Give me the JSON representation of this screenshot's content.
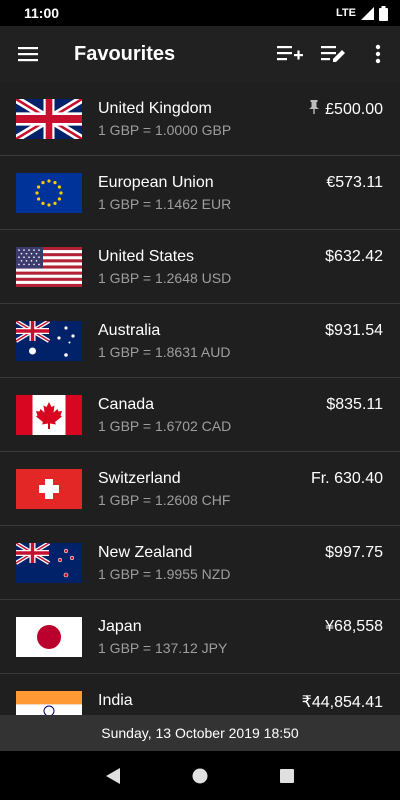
{
  "status": {
    "time": "11:00",
    "network": "LTE"
  },
  "appbar": {
    "title": "Favourites",
    "icons": [
      "menu-icon",
      "add-list-icon",
      "edit-list-icon",
      "more-vert-icon"
    ]
  },
  "rows": [
    {
      "country": "United Kingdom",
      "rate": "1 GBP = 1.0000 GBP",
      "amount": "£500.00",
      "flag": "uk",
      "pinned": true
    },
    {
      "country": "European Union",
      "rate": "1 GBP = 1.1462 EUR",
      "amount": "€573.11",
      "flag": "eu"
    },
    {
      "country": "United States",
      "rate": "1 GBP = 1.2648 USD",
      "amount": "$632.42",
      "flag": "us"
    },
    {
      "country": "Australia",
      "rate": "1 GBP = 1.8631 AUD",
      "amount": "$931.54",
      "flag": "au"
    },
    {
      "country": "Canada",
      "rate": "1 GBP = 1.6702 CAD",
      "amount": "$835.11",
      "flag": "ca"
    },
    {
      "country": "Switzerland",
      "rate": "1 GBP = 1.2608 CHF",
      "amount": "Fr. 630.40",
      "flag": "ch"
    },
    {
      "country": "New Zealand",
      "rate": "1 GBP = 1.9955 NZD",
      "amount": "$997.75",
      "flag": "nz"
    },
    {
      "country": "Japan",
      "rate": "1 GBP = 137.12 JPY",
      "amount": "¥68,558",
      "flag": "jp"
    },
    {
      "country": "India",
      "rate": "",
      "amount": "₹44,854.41",
      "flag": "in"
    }
  ],
  "footer": {
    "timestamp": "Sunday, 13 October 2019 18:50"
  },
  "colors": {
    "appbar": "#212121",
    "list": "#1f1f1f",
    "secondary_text": "#9e9e9e",
    "footer": "#333333"
  }
}
